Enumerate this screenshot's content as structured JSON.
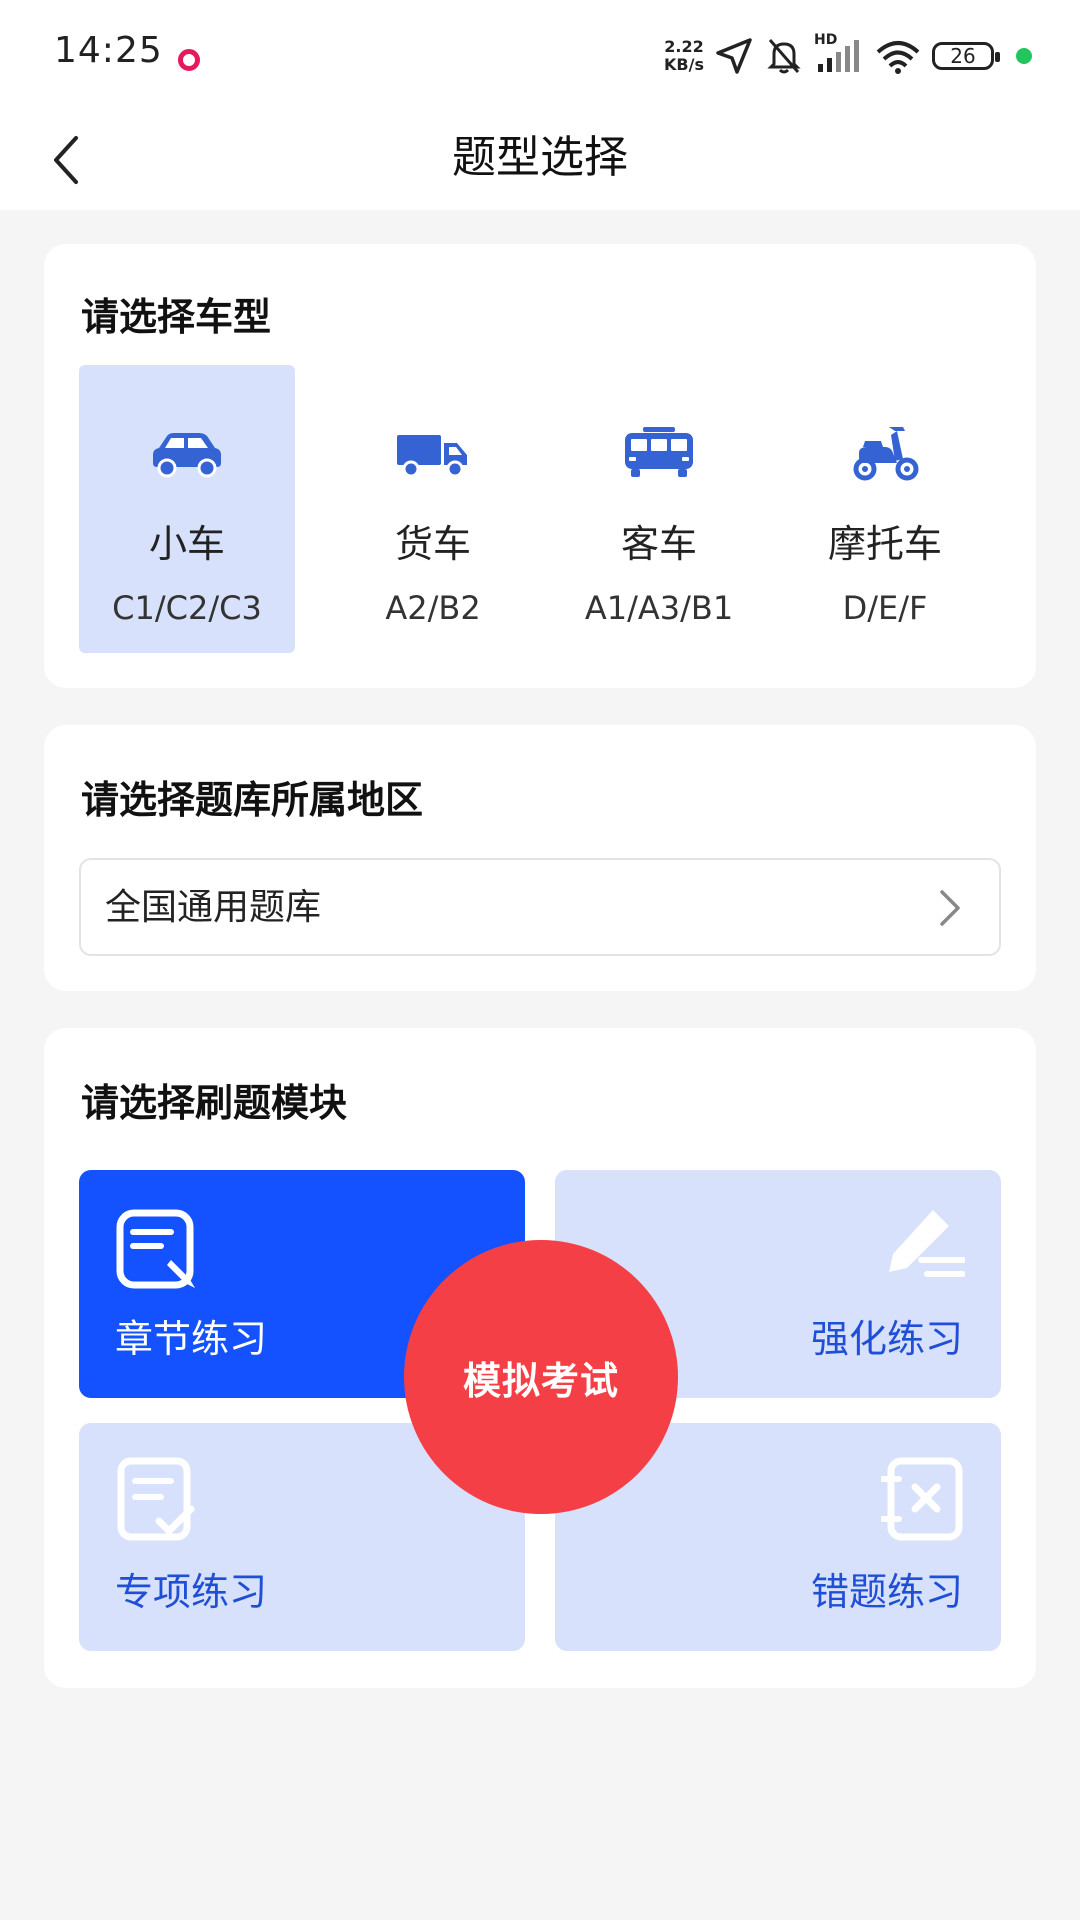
{
  "status_bar": {
    "time": "14:25",
    "speed_value": "2.22",
    "speed_unit": "KB/s",
    "battery": "26",
    "network_label": "HD",
    "icons": [
      "recording-dot-icon",
      "location-arrow-icon",
      "bell-muted-icon",
      "signal-icon",
      "wifi-icon",
      "battery-icon"
    ]
  },
  "nav": {
    "back_icon": "chevron-left-icon",
    "title": "题型选择"
  },
  "vehicle_section": {
    "title": "请选择车型",
    "selected_index": 0,
    "items": [
      {
        "name": "小车",
        "code": "C1/C2/C3",
        "icon": "car-icon"
      },
      {
        "name": "货车",
        "code": "A2/B2",
        "icon": "truck-icon"
      },
      {
        "name": "客车",
        "code": "A1/A3/B1",
        "icon": "bus-icon"
      },
      {
        "name": "摩托车",
        "code": "D/E/F",
        "icon": "scooter-icon"
      }
    ]
  },
  "region_section": {
    "title": "请选择题库所属地区",
    "value": "全国通用题库",
    "icon": "chevron-right-icon"
  },
  "module_section": {
    "title": "请选择刷题模块",
    "modules": [
      {
        "label": "章节练习",
        "icon": "note-edit-icon",
        "active": true
      },
      {
        "label": "强化练习",
        "icon": "pen-icon",
        "active": false
      },
      {
        "label": "专项练习",
        "icon": "checklist-icon",
        "active": false
      },
      {
        "label": "错题练习",
        "icon": "wrong-answer-icon",
        "active": false
      }
    ],
    "exam_label": "模拟考试"
  },
  "colors": {
    "primary": "#1552ff",
    "light_blue": "#d8e1fb",
    "icon_blue": "#3563d4",
    "exam_red": "#f43f46",
    "background": "#f5f5f5"
  }
}
